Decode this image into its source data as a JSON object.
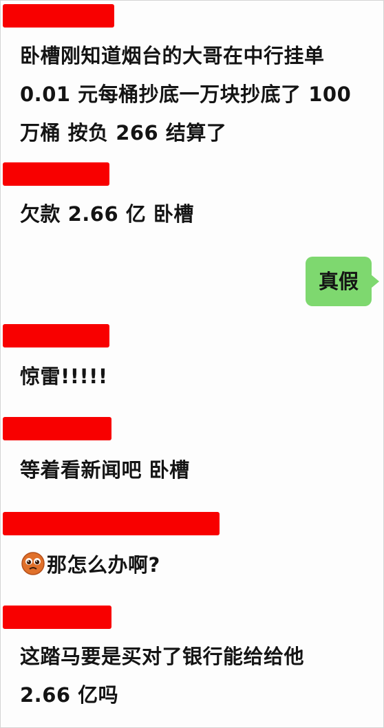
{
  "colors": {
    "redaction": "#f80000",
    "outgoing_bubble": "#7ed86f",
    "text": "#141414",
    "emoji_face": "#e0702a"
  },
  "messages": [
    {
      "sender": "redacted",
      "lines": [
        "卧槽刚知道烟台的大哥在中行挂单",
        "0.01 元每桶抄底一万块抄底了 100",
        "万桶 按负 266 结算了"
      ]
    },
    {
      "sender": "redacted",
      "lines": [
        "欠款 2.66 亿 卧槽"
      ]
    },
    {
      "sender": "me",
      "text": "真假"
    },
    {
      "sender": "redacted",
      "lines": [
        "惊雷!!!!!"
      ]
    },
    {
      "sender": "redacted",
      "lines": [
        "等着看新闻吧 卧槽"
      ]
    },
    {
      "sender": "redacted",
      "emoji": "pleading-face-icon",
      "lines": [
        "那怎么办啊?"
      ]
    },
    {
      "sender": "redacted",
      "lines": [
        "这踏马要是买对了银行能给给他",
        "2.66 亿吗"
      ]
    }
  ]
}
